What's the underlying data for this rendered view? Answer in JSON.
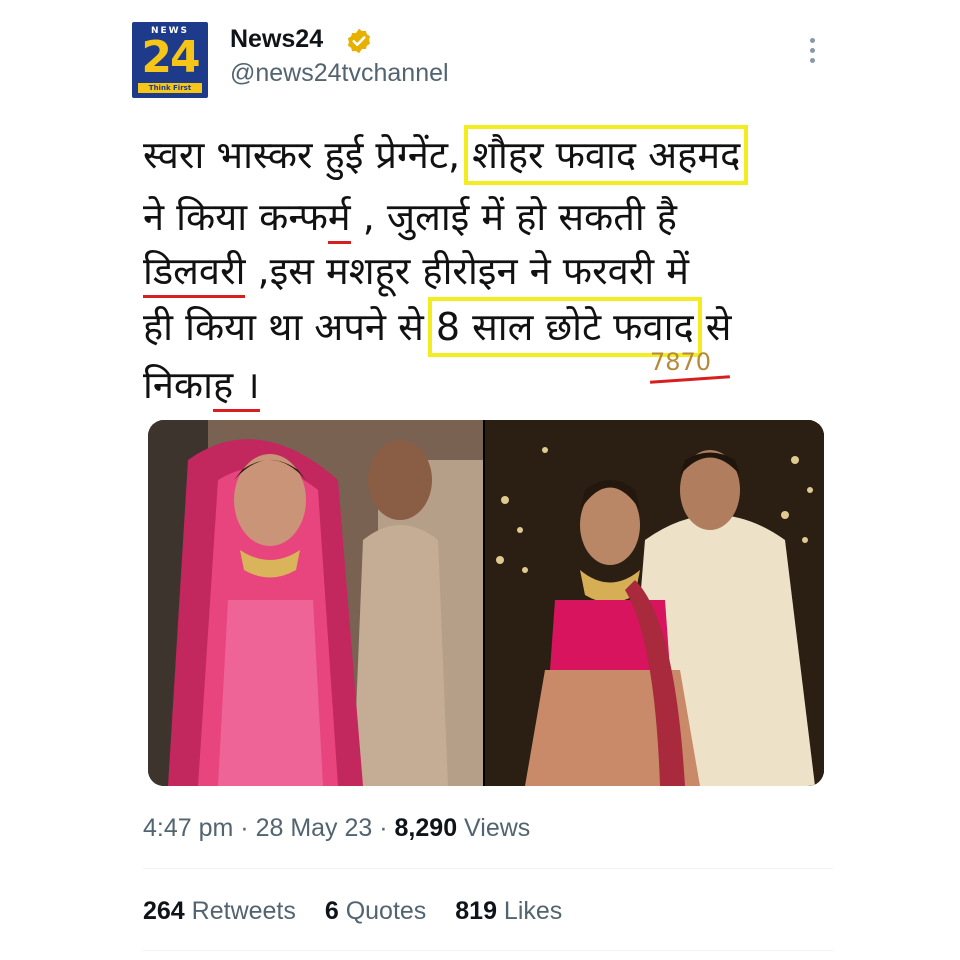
{
  "author": {
    "logo_top": "NEWS",
    "logo_number": "24",
    "logo_tagline": "Think First",
    "name": "News24",
    "handle": "@news24tvchannel"
  },
  "tweet": {
    "line1_a": "स्वरा भास्कर हुई प्रेग्नेंट, ",
    "line1_b": "शौहर फवाद अहमद",
    "line2_a": "ने किया कन्फ",
    "line2_b": "र्म",
    "line2_c": " , जुलाई में हो सकती है",
    "line3_a": "डिलवरी",
    "line3_b": " ,इस मशहूर हीरोइन ने फरवरी में",
    "line4_a": "ही किया था अपने से ",
    "line4_b": "8 साल छोटे फवाद",
    "line4_c": " से",
    "line5_a": "निका",
    "line5_b": "ह ।",
    "annotation": "7870"
  },
  "meta": {
    "time": "4:47 pm",
    "sep1": " · ",
    "date": "28 May 23",
    "sep2": " · ",
    "views_count": "8,290",
    "views_label": " Views"
  },
  "stats": {
    "retweets_count": "264",
    "retweets_label": " Retweets",
    "quotes_count": "6",
    "quotes_label": " Quotes",
    "likes_count": "819",
    "likes_label": " Likes"
  },
  "colors": {
    "highlight": "#f3ec1f",
    "underline": "#d81f1f",
    "verified": "#e8b000",
    "logo_bg": "#1d3b8a"
  }
}
